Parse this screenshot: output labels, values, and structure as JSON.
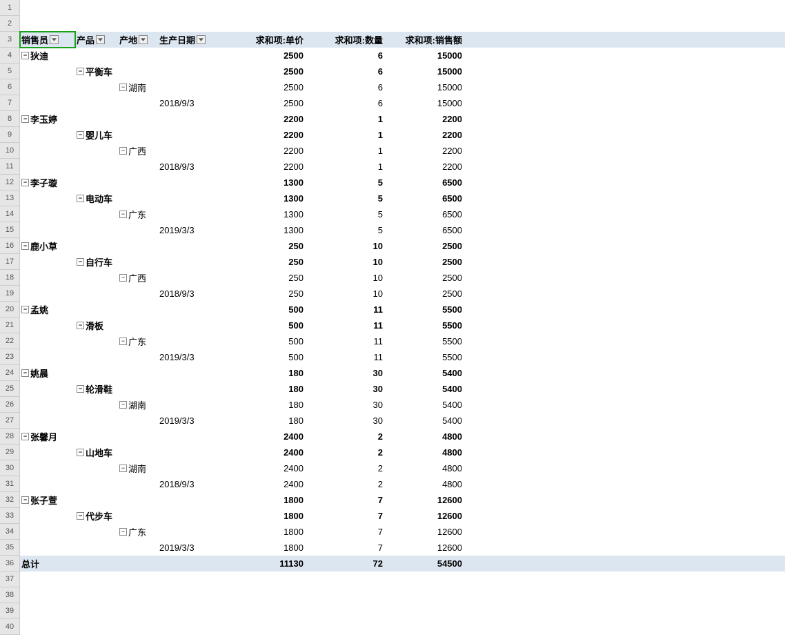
{
  "headers": {
    "salesperson": "销售员",
    "product": "产品",
    "origin": "产地",
    "prod_date": "生产日期",
    "sum_price": "求和项:单价",
    "sum_qty": "求和项:数量",
    "sum_sales": "求和项:销售额",
    "total": "总计"
  },
  "row_numbers": [
    "1",
    "2",
    "3",
    "4",
    "5",
    "6",
    "7",
    "8",
    "9",
    "10",
    "11",
    "12",
    "13",
    "14",
    "15",
    "16",
    "17",
    "18",
    "19",
    "20",
    "21",
    "22",
    "23",
    "24",
    "25",
    "26",
    "27",
    "28",
    "29",
    "30",
    "31",
    "32",
    "33",
    "34",
    "35",
    "36",
    "37",
    "38",
    "39",
    "40"
  ],
  "data": [
    {
      "sp": "狄迪",
      "product": "平衡车",
      "origin": "湖南",
      "date": "2018/9/3",
      "price": "2500",
      "qty": "6",
      "sales": "15000"
    },
    {
      "sp": "李玉婷",
      "product": "婴儿车",
      "origin": "广西",
      "date": "2018/9/3",
      "price": "2200",
      "qty": "1",
      "sales": "2200"
    },
    {
      "sp": "李子璇",
      "product": "电动车",
      "origin": "广东",
      "date": "2019/3/3",
      "price": "1300",
      "qty": "5",
      "sales": "6500"
    },
    {
      "sp": "鹿小草",
      "product": "自行车",
      "origin": "广西",
      "date": "2018/9/3",
      "price": "250",
      "qty": "10",
      "sales": "2500"
    },
    {
      "sp": "孟姚",
      "product": "滑板",
      "origin": "广东",
      "date": "2019/3/3",
      "price": "500",
      "qty": "11",
      "sales": "5500"
    },
    {
      "sp": "姚晨",
      "product": "轮滑鞋",
      "origin": "湖南",
      "date": "2019/3/3",
      "price": "180",
      "qty": "30",
      "sales": "5400"
    },
    {
      "sp": "张馨月",
      "product": "山地车",
      "origin": "湖南",
      "date": "2018/9/3",
      "price": "2400",
      "qty": "2",
      "sales": "4800"
    },
    {
      "sp": "张子萱",
      "product": "代步车",
      "origin": "广东",
      "date": "2019/3/3",
      "price": "1800",
      "qty": "7",
      "sales": "12600"
    }
  ],
  "totals": {
    "price": "11130",
    "qty": "72",
    "sales": "54500"
  }
}
